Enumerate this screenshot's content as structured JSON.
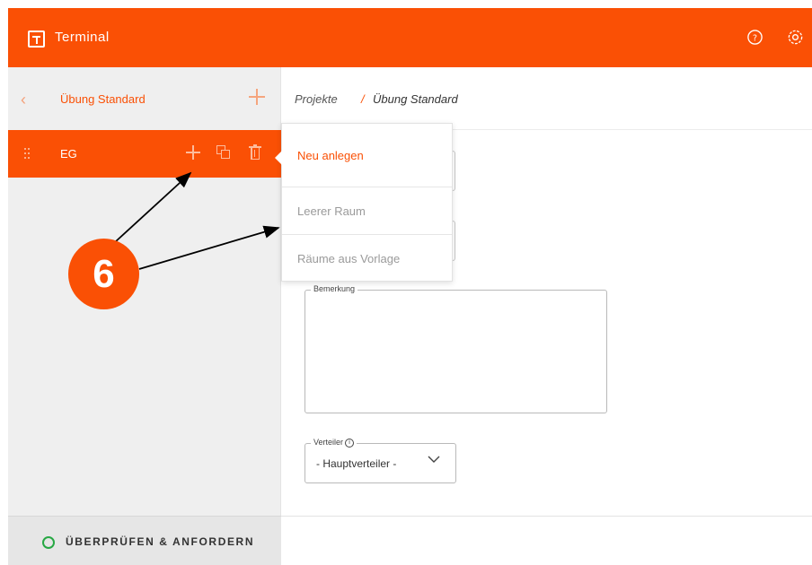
{
  "app": {
    "title": "Terminal"
  },
  "header_icons": {
    "help": "help-icon",
    "settings": "settings-icon"
  },
  "sidebar": {
    "project_name": "Übung Standard",
    "floor": {
      "label": "EG"
    },
    "footer_label": "ÜBERPRÜFEN & ANFORDERN"
  },
  "breadcrumb": {
    "root": "Projekte",
    "separator": "/",
    "current": "Übung Standard"
  },
  "form": {
    "remark_label": "Bemerkung",
    "distributor_label": "Verteiler",
    "distributor_value": "- Hauptverteiler -"
  },
  "dropdown": {
    "items": [
      {
        "label": "Neu anlegen"
      },
      {
        "label": "Leerer Raum"
      },
      {
        "label": "Räume aus Vorlage"
      }
    ]
  },
  "callout": {
    "number": "6"
  },
  "colors": {
    "accent": "#fa5005",
    "sidebar_bg": "#efefef",
    "status_ok": "#27a844"
  }
}
